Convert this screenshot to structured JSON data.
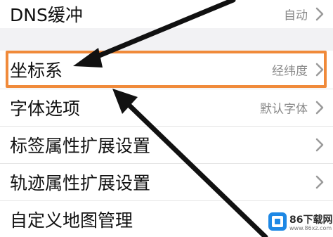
{
  "settings": {
    "dns": {
      "label": "DNS缓冲",
      "value": "自动"
    },
    "coordinate_system": {
      "label": "坐标系",
      "value": "经纬度"
    },
    "font_options": {
      "label": "字体选项",
      "value": "默认字体"
    },
    "marker_properties": {
      "label": "标签属性扩展设置"
    },
    "track_properties": {
      "label": "轨迹属性扩展设置"
    },
    "custom_map": {
      "label": "自定义地图管理"
    }
  },
  "watermark": {
    "name": "86下载网",
    "url": "www.86xz.com"
  },
  "colors": {
    "highlight_border": "#f08a3a",
    "arrow": "#111111",
    "section_gap": "#f2f2f4",
    "logo": "#1e88e5"
  },
  "icons": [
    "chevron-right-icon",
    "arrow-annotation",
    "watermark-logo-icon"
  ]
}
